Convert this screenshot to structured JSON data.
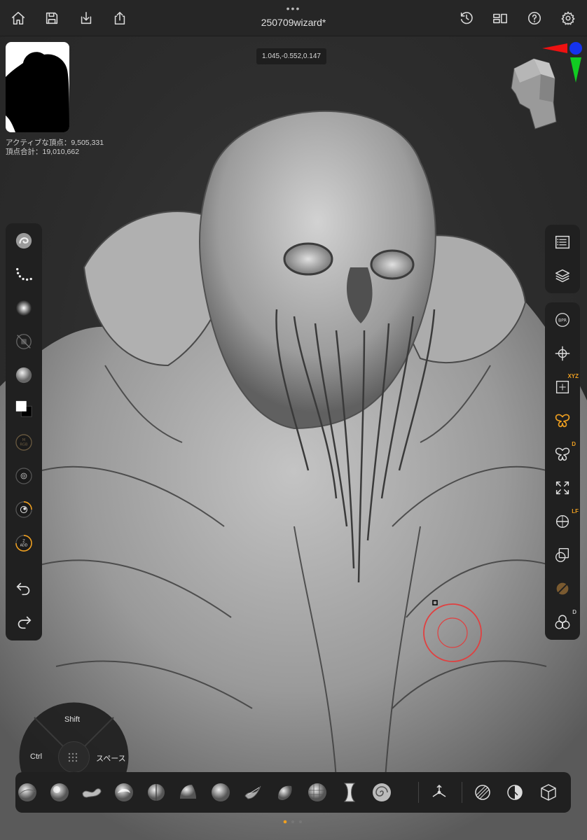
{
  "topbar": {
    "title": "250709wizard*",
    "more_dots": "•••",
    "icons": [
      "home-icon",
      "save-icon",
      "import-icon",
      "share-icon",
      "history-icon",
      "layout-icon",
      "help-icon",
      "settings-icon"
    ]
  },
  "viewport": {
    "coordinates": "1.045,-0.552,0.147",
    "active_vertices": "アクティブな頂点：9,505,331",
    "total_vertices": "頂点合計：19,010,662"
  },
  "left_toolbar": {
    "items": [
      "brush-icon",
      "stroke-icon",
      "alpha-icon",
      "texture-off-icon",
      "material-icon",
      "color-swatch-icon",
      "m-rgb-toggle",
      "focal-shift-dial",
      "draw-size-dial",
      "z-intensity-dial",
      "undo-icon",
      "redo-icon"
    ],
    "m_label": "M",
    "rgb_label": "RGB",
    "z_label": "Z",
    "add_label": "ADD"
  },
  "right_toolbar": {
    "top_items": [
      "tool-list-icon",
      "layers-icon"
    ],
    "items": [
      "bpr-icon",
      "transform-icon",
      "xyz-frame-icon",
      "symmetry-icon",
      "radial-symmetry-icon",
      "frame-icon",
      "floor-icon",
      "transparent-icon",
      "solo-icon",
      "polypaint-icon"
    ],
    "bpr_label": "BPR",
    "xyz_label": "XYZ",
    "d_label": "D",
    "lf_label": "LF"
  },
  "pie_menu": {
    "shift": "Shift",
    "ctrl": "Ctrl",
    "space": "スペース"
  },
  "brush_tray": {
    "brushes": [
      "standard-brush",
      "clay-brush",
      "move-brush",
      "clay-buildup-brush",
      "dam-standard-brush",
      "hpolish-brush",
      "smooth-brush",
      "snakehook-brush",
      "inflate-brush",
      "trimdynamic-brush",
      "pinch-brush",
      "curve-brush"
    ],
    "extra": [
      "gizmo-icon",
      "matcap-icon",
      "fill-icon",
      "box-icon"
    ]
  },
  "colors": {
    "accent": "#f0a020",
    "panel": "#202020",
    "topbar": "#262626"
  }
}
